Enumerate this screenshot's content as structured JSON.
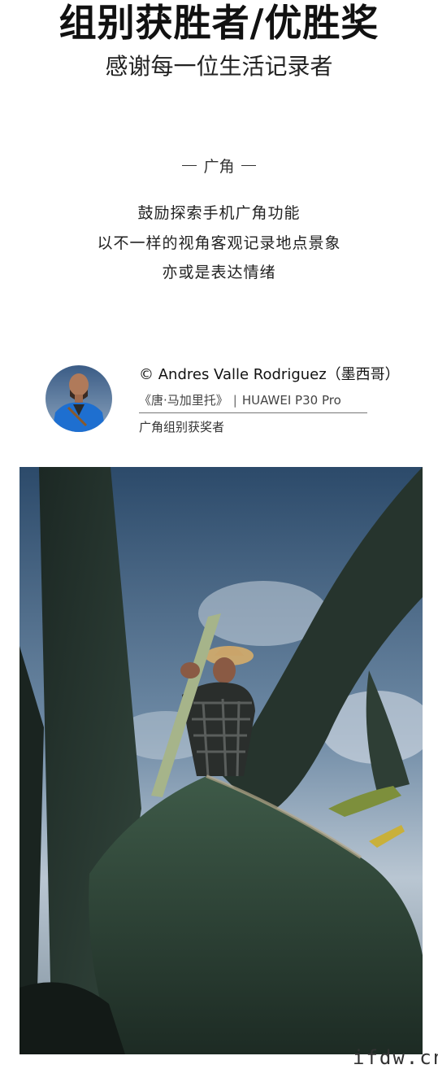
{
  "header": {
    "title": "组别获胜者/优胜奖",
    "subtitle": "感谢每一位生活记录者"
  },
  "category": {
    "label": "广角",
    "description_lines": [
      "鼓励探索手机广角功能",
      "以不一样的视角客观记录地点景象",
      "亦或是表达情绪"
    ]
  },
  "photographer": {
    "credit": "© Andres Valle Rodriguez（墨西哥）",
    "work_title": "《唐·马加里托》",
    "separator": "|",
    "device": "HUAWEI P30 Pro",
    "award": "广角组别获奖者"
  },
  "watermark": "ifdw.cn",
  "colors": {
    "sky": "#5f7f9f",
    "agave": "#2f3f36",
    "jacket": "#1e6fd0"
  }
}
